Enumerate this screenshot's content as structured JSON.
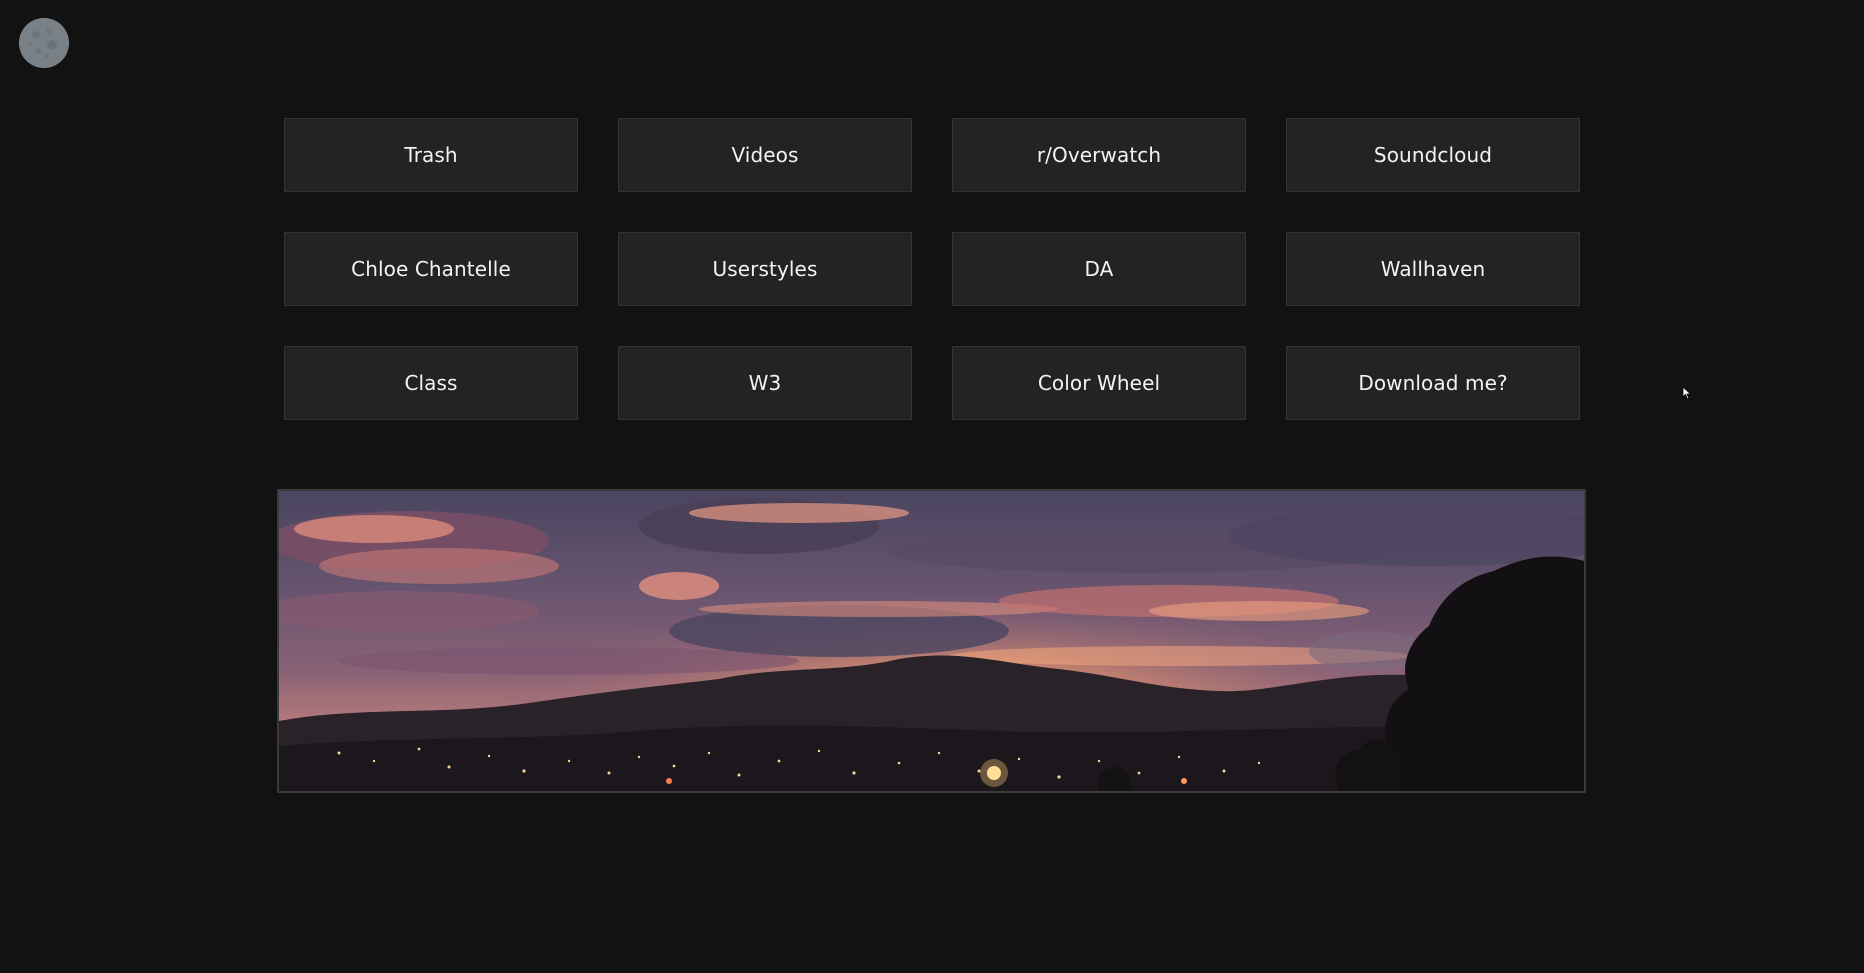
{
  "avatar": {
    "icon": "moon-icon",
    "color": "#7a8288"
  },
  "links": [
    {
      "label": "Trash"
    },
    {
      "label": "Videos"
    },
    {
      "label": "r/Overwatch"
    },
    {
      "label": "Soundcloud"
    },
    {
      "label": "Chloe Chantelle"
    },
    {
      "label": "Userstyles"
    },
    {
      "label": "DA"
    },
    {
      "label": "Wallhaven"
    },
    {
      "label": "Class"
    },
    {
      "label": "W3"
    },
    {
      "label": "Color Wheel"
    },
    {
      "label": "Download me?"
    }
  ],
  "colors": {
    "background": "#121213",
    "button_bg": "#232324",
    "button_border": "#333336",
    "button_text": "#f3f3f3"
  },
  "banner": {
    "icon": "sunset-cityscape-image"
  }
}
